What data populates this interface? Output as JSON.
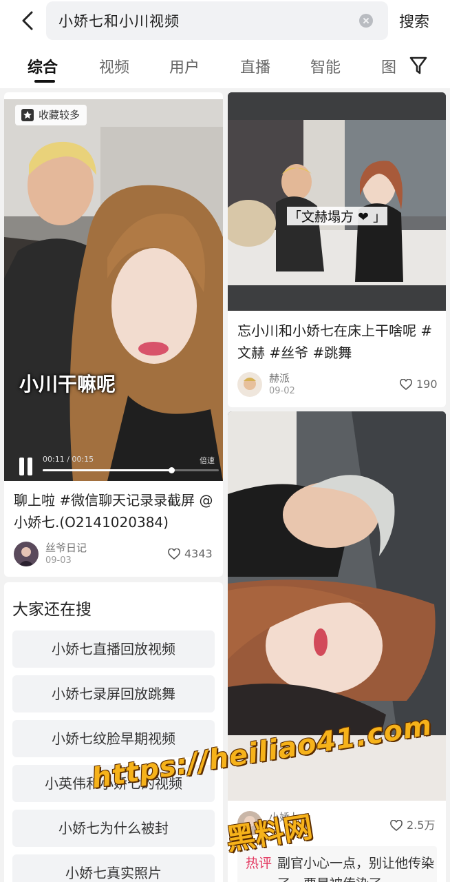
{
  "header": {
    "query": "小娇七和小川视频",
    "search_label": "搜索"
  },
  "tabs": [
    "综合",
    "视频",
    "用户",
    "直播",
    "智能",
    "图"
  ],
  "colors": {
    "accent_hot": "#e33a62",
    "watermark": "#f6b21a"
  },
  "cards": [
    {
      "badge": "收藏较多",
      "overlay": "小川干嘛呢",
      "video": {
        "time": "00:11 / 00:15",
        "speed": "倍速",
        "progress": 0.73
      },
      "title": "聊上啦 #微信聊天记录录截屏 @小娇七.(O2141020384)",
      "author": "丝爷日记",
      "date": "09-03",
      "likes": "4343"
    },
    {
      "overlay": "「文赫塌方 ❤ 」",
      "title": "忘小川和小娇七在床上干啥呢 #文赫 #丝爷 #跳舞",
      "author": "赫派",
      "date": "09-02",
      "likes": "190"
    },
    {
      "author": "小娇七",
      "likes": "2.5万",
      "hot_label": "热评",
      "hot_text": "副官小心一点，别让他传染了，要是被传染了"
    }
  ],
  "suggestions": {
    "title": "大家还在搜",
    "items": [
      "小娇七直播回放视频",
      "小娇七录屏回放跳舞",
      "小娇七纹脸早期视频",
      "小英伟和小娇七的视频",
      "小娇七为什么被封",
      "小娇七真实照片"
    ]
  },
  "watermark": {
    "url": "https://heiliao41.com",
    "name": "黑料网"
  }
}
